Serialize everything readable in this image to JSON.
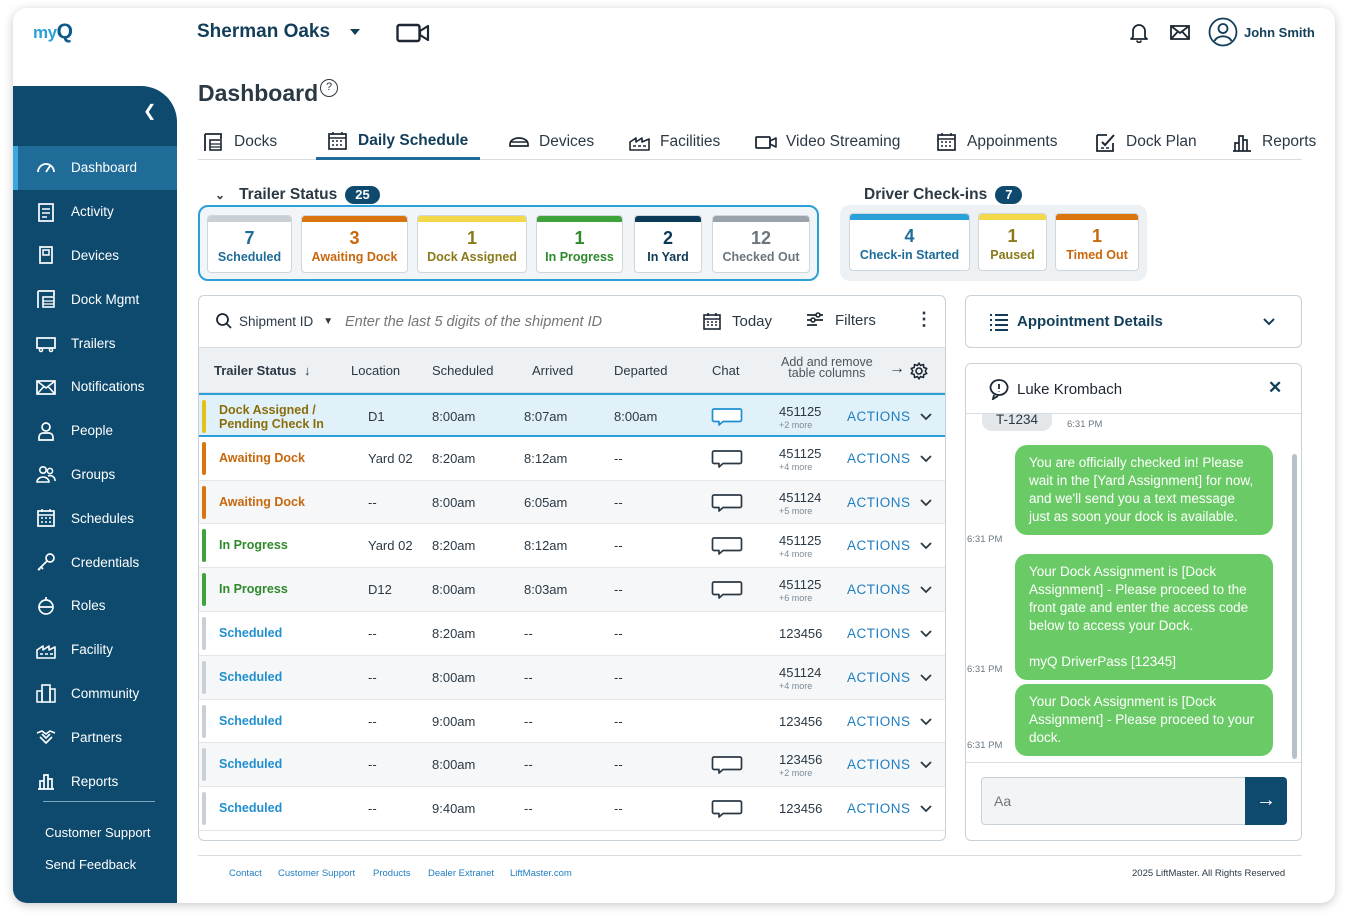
{
  "header": {
    "logo_text": "my",
    "logo_q": "Q",
    "location": "Sherman Oaks",
    "user_name": "John Smith"
  },
  "sidebar": {
    "items": [
      {
        "label": "Dashboard",
        "icon": "dashboard-icon",
        "active": true
      },
      {
        "label": "Activity",
        "icon": "activity-icon"
      },
      {
        "label": "Devices",
        "icon": "devices-icon"
      },
      {
        "label": "Dock Mgmt",
        "icon": "dock-icon"
      },
      {
        "label": "Trailers",
        "icon": "trailer-icon"
      },
      {
        "label": "Notifications",
        "icon": "mail-icon"
      },
      {
        "label": "People",
        "icon": "person-icon"
      },
      {
        "label": "Groups",
        "icon": "groups-icon"
      },
      {
        "label": "Schedules",
        "icon": "calendar-icon"
      },
      {
        "label": "Credentials",
        "icon": "key-icon"
      },
      {
        "label": "Roles",
        "icon": "roles-icon"
      },
      {
        "label": "Facility",
        "icon": "facility-icon"
      },
      {
        "label": "Community",
        "icon": "community-icon"
      },
      {
        "label": "Partners",
        "icon": "handshake-icon"
      },
      {
        "label": "Reports",
        "icon": "reports-icon"
      }
    ],
    "customer_support": "Customer Support",
    "send_feedback": "Send Feedback"
  },
  "page": {
    "title": "Dashboard",
    "help": "?"
  },
  "tabs": [
    {
      "label": "Docks",
      "icon": "docks-icon"
    },
    {
      "label": "Daily Schedule",
      "icon": "calendar-icon",
      "active": true
    },
    {
      "label": "Devices",
      "icon": "devices-icon"
    },
    {
      "label": "Facilities",
      "icon": "facility-icon"
    },
    {
      "label": "Video Streaming",
      "icon": "camera-icon"
    },
    {
      "label": "Appoinments",
      "icon": "calendar-icon"
    },
    {
      "label": "Dock Plan",
      "icon": "dock-plan-icon"
    },
    {
      "label": "Reports",
      "icon": "reports-icon"
    }
  ],
  "trailer_status": {
    "title": "Trailer Status",
    "count": "25",
    "cards": [
      {
        "num": "7",
        "label": "Scheduled",
        "bar": "#c9cfd4",
        "color": "#1f6c98"
      },
      {
        "num": "3",
        "label": "Awaiting Dock",
        "bar": "#d9740f",
        "color": "#c8670c"
      },
      {
        "num": "1",
        "label": "Dock Assigned",
        "bar": "#f3d94a",
        "color": "#8a7a1a"
      },
      {
        "num": "1",
        "label": "In Progress",
        "bar": "#3ea33a",
        "color": "#2f8a2c"
      },
      {
        "num": "2",
        "label": "In Yard",
        "bar": "#0d3a57",
        "color": "#0d3a57"
      },
      {
        "num": "12",
        "label": "Checked Out",
        "bar": "#9aa3aa",
        "color": "#6b757d"
      }
    ]
  },
  "driver_checkins": {
    "title": "Driver Check-ins",
    "count": "7",
    "cards": [
      {
        "num": "4",
        "label": "Check-in Started",
        "bar": "#2a9fd8",
        "color": "#1f6c98"
      },
      {
        "num": "1",
        "label": "Paused",
        "bar": "#f3d94a",
        "color": "#8a7a1a"
      },
      {
        "num": "1",
        "label": "Timed Out",
        "bar": "#d9740f",
        "color": "#c8670c"
      }
    ]
  },
  "search": {
    "field": "Shipment ID",
    "placeholder": "Enter the last 5 digits of the shipment ID",
    "date": "Today",
    "filters": "Filters"
  },
  "table": {
    "headers": {
      "status": "Trailer Status",
      "location": "Location",
      "scheduled": "Scheduled",
      "arrived": "Arrived",
      "departed": "Departed",
      "chat": "Chat",
      "add_remove_1": "Add and remove",
      "add_remove_2": "table columns"
    },
    "action_label": "ACTIONS",
    "rows": [
      {
        "status1": "Dock Assigned /",
        "status2": "Pending Check In",
        "color": "#e5c21b",
        "text_color": "#8a6d0a",
        "location": "D1",
        "scheduled": "8:00am",
        "arrived": "8:07am",
        "departed": "8:00am",
        "chat": true,
        "chat_blue": true,
        "sid": "451125",
        "more": "+2 more",
        "selected": true
      },
      {
        "status1": "Awaiting Dock",
        "color": "#d9740f",
        "text_color": "#c8670c",
        "location": "Yard 02",
        "scheduled": "8:20am",
        "arrived": "8:12am",
        "departed": "--",
        "chat": true,
        "sid": "451125",
        "more": "+4 more"
      },
      {
        "status1": "Awaiting Dock",
        "color": "#d9740f",
        "text_color": "#c8670c",
        "location": "--",
        "scheduled": "8:00am",
        "arrived": "6:05am",
        "departed": "--",
        "chat": true,
        "sid": "451124",
        "more": "+5 more"
      },
      {
        "status1": "In Progress",
        "color": "#3ea33a",
        "text_color": "#2f8a2c",
        "location": "Yard 02",
        "scheduled": "8:20am",
        "arrived": "8:12am",
        "departed": "--",
        "chat": true,
        "sid": "451125",
        "more": "+4 more"
      },
      {
        "status1": "In Progress",
        "color": "#3ea33a",
        "text_color": "#2f8a2c",
        "location": "D12",
        "scheduled": "8:00am",
        "arrived": "8:03am",
        "departed": "--",
        "chat": true,
        "sid": "451125",
        "more": "+6 more"
      },
      {
        "status1": "Scheduled",
        "color": "#c9cfd4",
        "text_color": "#1f8fd0",
        "location": "--",
        "scheduled": "8:20am",
        "arrived": "--",
        "departed": "--",
        "chat": false,
        "sid": "123456",
        "more": ""
      },
      {
        "status1": "Scheduled",
        "color": "#c9cfd4",
        "text_color": "#1f8fd0",
        "location": "--",
        "scheduled": "8:00am",
        "arrived": "--",
        "departed": "--",
        "chat": false,
        "sid": "451124",
        "more": "+4 more"
      },
      {
        "status1": "Scheduled",
        "color": "#c9cfd4",
        "text_color": "#1f8fd0",
        "location": "--",
        "scheduled": "9:00am",
        "arrived": "--",
        "departed": "--",
        "chat": false,
        "sid": "123456",
        "more": ""
      },
      {
        "status1": "Scheduled",
        "color": "#c9cfd4",
        "text_color": "#1f8fd0",
        "location": "--",
        "scheduled": "8:00am",
        "arrived": "--",
        "departed": "--",
        "chat": true,
        "sid": "123456",
        "more": "+2 more"
      },
      {
        "status1": "Scheduled",
        "color": "#c9cfd4",
        "text_color": "#1f8fd0",
        "location": "--",
        "scheduled": "9:40am",
        "arrived": "--",
        "departed": "--",
        "chat": true,
        "sid": "123456",
        "more": ""
      }
    ]
  },
  "appointment": {
    "title": "Appointment Details"
  },
  "chat": {
    "driver": "Luke Krombach",
    "prev_label": "T-1234",
    "prev_time": "6:31 PM",
    "messages": [
      {
        "text": "You are officially checked in! Please wait in the [Yard Assignment] for now, and we'll send you a text message just as soon your dock is available.",
        "time": "6:31 PM"
      },
      {
        "text": "Your Dock Assignment is [Dock Assignment] - Please proceed to the front gate and enter the access code below to access your Dock.",
        "extra": "myQ DriverPass [12345]",
        "time": "6:31 PM"
      },
      {
        "text": "Your Dock Assignment is [Dock Assignment] - Please proceed to your dock.",
        "time": "6:31 PM"
      }
    ],
    "input_placeholder": "Aa"
  },
  "footer": {
    "links": [
      "Contact",
      "Customer Support",
      "Products",
      "Dealer Extranet",
      "LiftMaster.com"
    ],
    "copyright": "2025 LiftMaster. All Rights Reserved"
  }
}
